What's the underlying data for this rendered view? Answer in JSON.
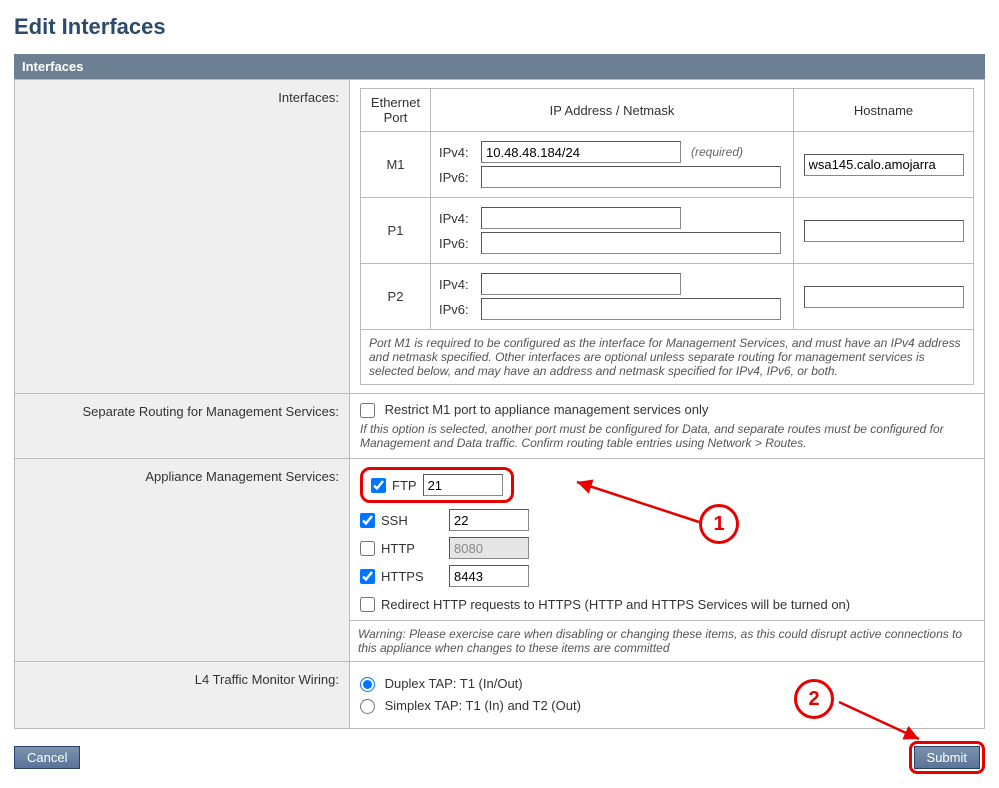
{
  "page": {
    "title": "Edit Interfaces"
  },
  "section": {
    "interfaces": "Interfaces"
  },
  "labels": {
    "interfaces": "Interfaces:",
    "separate_routing": "Separate Routing for Management Services:",
    "appliance_services": "Appliance Management Services:",
    "l4_wiring": "L4 Traffic Monitor Wiring:"
  },
  "inner_headers": {
    "port": "Ethernet Port",
    "ip": "IP Address / Netmask",
    "host": "Hostname"
  },
  "ports": {
    "m1": {
      "name": "M1",
      "ipv4_label": "IPv4:",
      "ipv6_label": "IPv6:",
      "ipv4_value": "10.48.48.184/24",
      "ipv6_value": "",
      "required": "(required)",
      "hostname": "wsa145.calo.amojarra"
    },
    "p1": {
      "name": "P1",
      "ipv4_label": "IPv4:",
      "ipv6_label": "IPv6:",
      "ipv4_value": "",
      "ipv6_value": "",
      "hostname": ""
    },
    "p2": {
      "name": "P2",
      "ipv4_label": "IPv4:",
      "ipv6_label": "IPv6:",
      "ipv4_value": "",
      "ipv6_value": "",
      "hostname": ""
    }
  },
  "notes": {
    "ports_note": "Port M1 is required to be configured as the interface for Management Services, and must have an IPv4 address and netmask specified. Other interfaces are optional unless separate routing for management services is selected below, and may have an address and netmask specified for IPv4, IPv6, or both.",
    "routing_note": "If this option is selected, another port must be configured for Data, and separate routes must be configured for Management and Data traffic. Confirm routing table entries using Network > Routes.",
    "services_warning": "Warning: Please exercise care when disabling or changing these items, as this could disrupt active connections to this appliance when changes to these items are committed"
  },
  "routing": {
    "restrict_label": "Restrict M1 port to appliance management services only"
  },
  "services": {
    "ftp": {
      "label": "FTP",
      "port": "21",
      "checked": true
    },
    "ssh": {
      "label": "SSH",
      "port": "22",
      "checked": true
    },
    "http": {
      "label": "HTTP",
      "port": "8080",
      "checked": false
    },
    "https": {
      "label": "HTTPS",
      "port": "8443",
      "checked": true
    },
    "redirect_label": "Redirect HTTP requests to HTTPS (HTTP and HTTPS Services will be turned on)"
  },
  "l4": {
    "duplex": "Duplex TAP: T1 (In/Out)",
    "simplex": "Simplex TAP: T1 (In) and T2 (Out)"
  },
  "buttons": {
    "cancel": "Cancel",
    "submit": "Submit"
  },
  "annotations": {
    "one": "1",
    "two": "2"
  }
}
